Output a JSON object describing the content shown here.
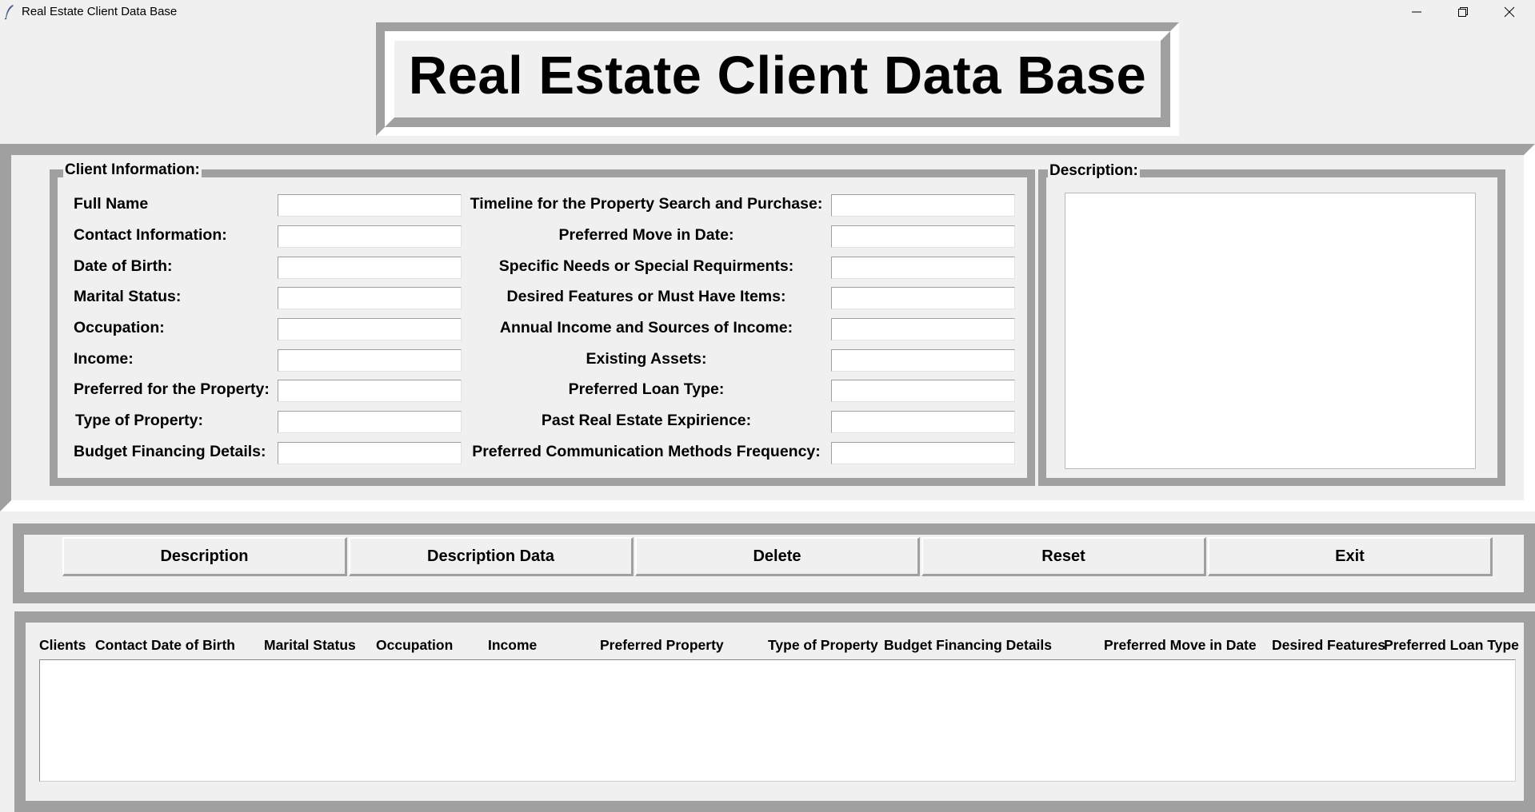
{
  "window": {
    "title": "Real Estate Client Data Base",
    "icon": "feather-icon",
    "controls": [
      "minimize-icon",
      "restore-icon",
      "close-icon"
    ]
  },
  "heading": "Real Estate Client Data Base",
  "client_info": {
    "group_label": "Client Information:",
    "left_fields": [
      {
        "label": "Full Name",
        "value": ""
      },
      {
        "label": "Contact Information:",
        "value": ""
      },
      {
        "label": "Date of Birth:",
        "value": ""
      },
      {
        "label": "Marital Status:",
        "value": ""
      },
      {
        "label": "Occupation:",
        "value": ""
      },
      {
        "label": "Income:",
        "value": ""
      },
      {
        "label": "Preferred for the Property:",
        "value": ""
      },
      {
        "label": "Type of Property:",
        "value": ""
      },
      {
        "label": "Budget Financing Details:",
        "value": ""
      }
    ],
    "right_fields": [
      {
        "label": "Timeline for the Property Search and Purchase:",
        "value": ""
      },
      {
        "label": "Preferred Move in Date:",
        "value": ""
      },
      {
        "label": "Specific Needs or Special Requirments:",
        "value": ""
      },
      {
        "label": "Desired Features or Must Have Items:",
        "value": ""
      },
      {
        "label": "Annual Income and Sources of Income:",
        "value": ""
      },
      {
        "label": "Existing Assets:",
        "value": ""
      },
      {
        "label": "Preferred Loan Type:",
        "value": ""
      },
      {
        "label": "Past Real Estate Expirience:",
        "value": ""
      },
      {
        "label": "Preferred Communication Methods Frequency:",
        "value": ""
      }
    ]
  },
  "description": {
    "group_label": "Description:",
    "text": ""
  },
  "buttons": {
    "description": "Description",
    "description_data": "Description Data",
    "delete": "Delete",
    "reset": "Reset",
    "exit": "Exit"
  },
  "table": {
    "columns": [
      "Clients",
      "Contact",
      "Date of Birth",
      "Marital Status",
      "Occupation",
      "Income",
      "Preferred Property",
      "Type of Property",
      "Budget Financing Details",
      "Preferred Move in Date",
      "Desired Features",
      "Preferred Loan Type"
    ],
    "rows": []
  }
}
